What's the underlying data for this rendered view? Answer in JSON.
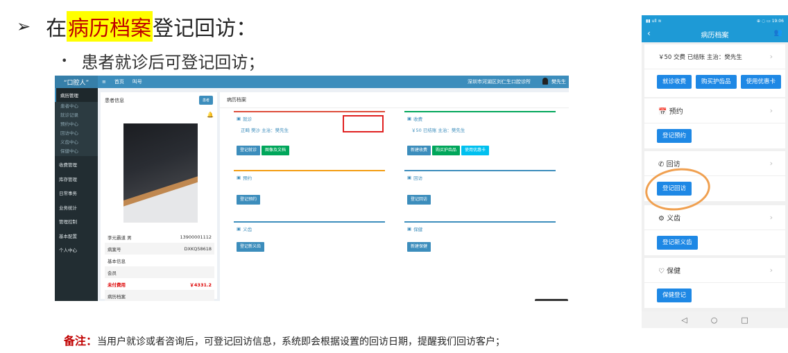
{
  "slide": {
    "arrow": "➢",
    "heading_before": "在",
    "heading_highlight": "病历档案",
    "heading_after": "登记回访：",
    "bullet": "•",
    "subheading": "患者就诊后可登记回访；",
    "note_label": "备注：",
    "note_text": "当用户就诊或者咨询后，可登记回访信息，系统即会根据设置的回访日期，提醒我们回访客户；"
  },
  "desktop": {
    "logo": "“口腔人”",
    "menu_toggle": "≡",
    "nav": [
      "首页",
      "叫号"
    ],
    "clinic": "深圳市河湖区刘仁生口腔诊所",
    "user": "樊先生",
    "sidebar": {
      "group": "病历管理",
      "sub_items": [
        "患者中心",
        "就诊记录",
        "预约中心",
        "回访中心",
        "义齿中心",
        "保健中心"
      ],
      "items": [
        "收费管理",
        "库存管理",
        "日常事务",
        "业务统计",
        "管理控制",
        "基本配置",
        "个人中心"
      ]
    },
    "patient": {
      "title": "患者信息",
      "button": "患者",
      "bell_icon": "bell-icon",
      "name": "李元霸道 男",
      "phone": "13900001112",
      "record_label": "病案号",
      "record_no": "DXKQ58618",
      "basic": "基本信息",
      "member": "会员",
      "unpaid_label": "未付费用",
      "unpaid_amount": "￥4331.2",
      "archive": "病历档案"
    },
    "main_title": "病历档案",
    "cards": {
      "visit": {
        "title": "就诊",
        "info": "正畸 樊沙 主治：樊先生",
        "buttons": [
          "登记就诊",
          "图像及文档"
        ]
      },
      "charge": {
        "title": "收费",
        "info": "￥50 已结账 主治：樊先生",
        "buttons": [
          "新建收费",
          "购买护齿品",
          "使用优惠卡"
        ]
      },
      "appoint": {
        "title": "预约",
        "buttons": [
          "登记预约"
        ]
      },
      "revisit": {
        "title": "回访",
        "buttons": [
          "登记回访"
        ]
      },
      "denture": {
        "title": "义齿",
        "buttons": [
          "登记新义齿"
        ]
      },
      "health": {
        "title": "保健",
        "buttons": [
          "新建保健"
        ]
      }
    },
    "colors": {
      "accent": "#3c8dbc",
      "sidebar": "#222d32",
      "highlight_box": "#e02020"
    }
  },
  "phone": {
    "status_left": "▮▮ ull ≋",
    "status_right": "⊕ ◌ ▭ 19:06",
    "title": "病历档案",
    "back_icon": "‹",
    "users_icon": "👥",
    "charge_info": "￥50 交费 已结账 主治：樊先生",
    "charge_buttons": [
      "就诊收费",
      "购买护齿品",
      "使用优惠卡"
    ],
    "sections": [
      {
        "icon": "📅",
        "label": "预约",
        "button": "登记预约"
      },
      {
        "icon": "✆",
        "label": "回访",
        "button": "登记回访"
      },
      {
        "icon": "⚙",
        "label": "义齿",
        "button": "登记新义齿"
      },
      {
        "icon": "♡",
        "label": "保健",
        "button": "保健登记"
      }
    ],
    "chevron": "›",
    "nav_buttons": [
      "◁",
      "○",
      "□"
    ],
    "colors": {
      "bar": "#1e9ad6",
      "button": "#1e88e5",
      "circle": "#f0a050"
    }
  }
}
